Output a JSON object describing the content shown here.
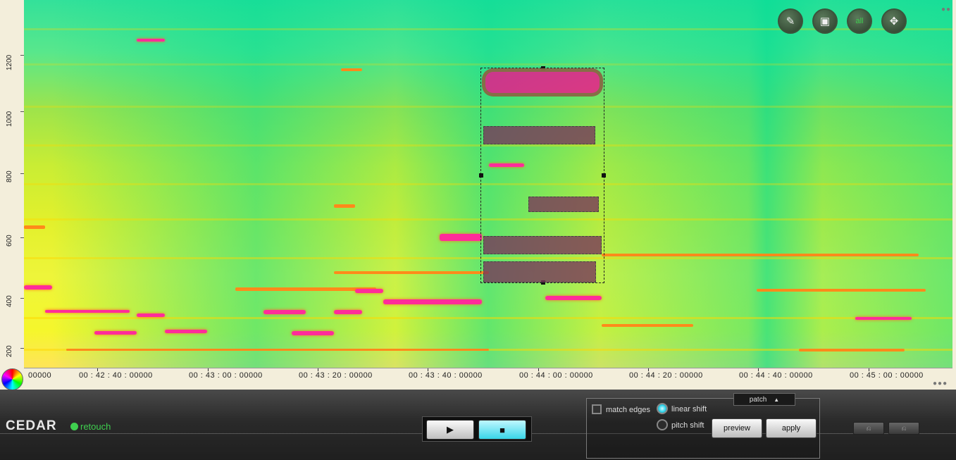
{
  "app": {
    "logo": "CEDAR",
    "product": "retouch"
  },
  "y_axis": {
    "labels": [
      "200",
      "400",
      "600",
      "800",
      "1000",
      "1200"
    ]
  },
  "x_axis": {
    "labels": [
      "00000",
      "00 : 42 : 40 : 00000",
      "00 : 43 : 00 : 00000",
      "00 : 43 : 20 : 00000",
      "00 : 43 : 40 : 00000",
      "00 : 44 : 00 : 00000",
      "00 : 44 : 20 : 00000",
      "00 : 44 : 40 : 00000",
      "00 : 45 : 00 : 00000"
    ]
  },
  "tools": [
    {
      "name": "brush-tool",
      "icon": "brush-icon",
      "glyph": "✎"
    },
    {
      "name": "rect-select-tool",
      "icon": "rect-select-icon",
      "glyph": "▣"
    },
    {
      "name": "select-all-tool",
      "icon": "all-icon",
      "glyph": "all"
    },
    {
      "name": "move-tool",
      "icon": "move-icon",
      "glyph": "✥"
    }
  ],
  "transport": {
    "play_glyph": "▶",
    "stop_glyph": "■"
  },
  "options": {
    "panel_label": "patch",
    "panel_arrow": "▲",
    "match_edges": "match edges",
    "linear_shift": "linear shift",
    "pitch_shift": "pitch shift",
    "preview": "preview",
    "apply": "apply",
    "linear_shift_selected": true,
    "match_edges_checked": false
  },
  "extra_buttons": [
    "⎌",
    "⎌"
  ],
  "colors": {
    "accent": "#39d5e8",
    "brand_green": "#3fcf4f",
    "hot": "#ff2c9a"
  }
}
